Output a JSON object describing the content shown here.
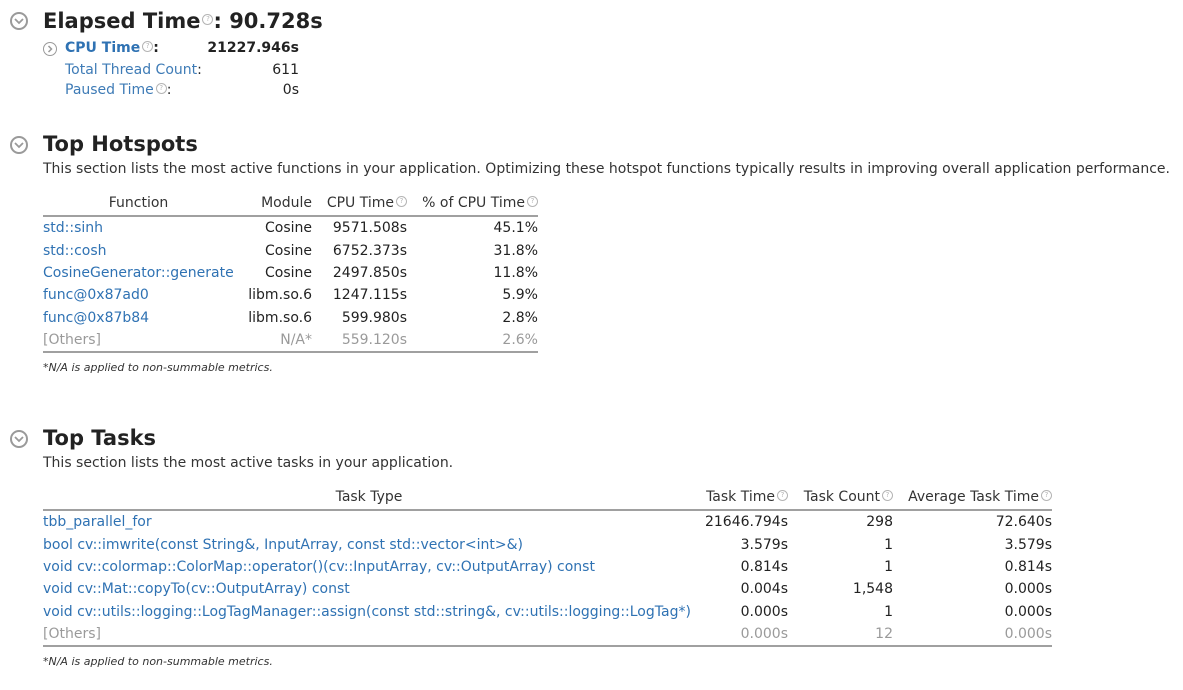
{
  "elapsed": {
    "title": "Elapsed Time",
    "value": ": 90.728s",
    "metrics": [
      {
        "label": "CPU Time",
        "value": "21227.946s"
      },
      {
        "label": "Total Thread Count",
        "value": "611"
      },
      {
        "label": "Paused Time",
        "value": "0s"
      }
    ]
  },
  "hotspots": {
    "title": "Top Hotspots",
    "description": "This section lists the most active functions in your application. Optimizing these hotspot functions typically results in improving overall application performance.",
    "headers": [
      "Function",
      "Module",
      "CPU Time",
      "% of CPU Time"
    ],
    "rows": [
      [
        "std::sinh",
        "Cosine",
        "9571.508s",
        "45.1%"
      ],
      [
        "std::cosh",
        "Cosine",
        "6752.373s",
        "31.8%"
      ],
      [
        "CosineGenerator::generate",
        "Cosine",
        "2497.850s",
        "11.8%"
      ],
      [
        "func@0x87ad0",
        "libm.so.6",
        "1247.115s",
        "5.9%"
      ],
      [
        "func@0x87b84",
        "libm.so.6",
        "599.980s",
        "2.8%"
      ],
      [
        "[Others]",
        "N/A*",
        "559.120s",
        "2.6%"
      ]
    ],
    "footnote": "*N/A is applied to non-summable metrics."
  },
  "tasks": {
    "title": "Top Tasks",
    "description": "This section lists the most active tasks in your application.",
    "headers": [
      "Task Type",
      "Task Time",
      "Task Count",
      "Average Task Time"
    ],
    "rows": [
      [
        "tbb_parallel_for",
        "21646.794s",
        "298",
        "72.640s"
      ],
      [
        "bool cv::imwrite(const String&, InputArray, const std::vector<int>&)",
        "3.579s",
        "1",
        "3.579s"
      ],
      [
        "void cv::colormap::ColorMap::operator()(cv::InputArray, cv::OutputArray) const",
        "0.814s",
        "1",
        "0.814s"
      ],
      [
        "void cv::Mat::copyTo(cv::OutputArray) const",
        "0.004s",
        "1,548",
        "0.000s"
      ],
      [
        "void cv::utils::logging::LogTagManager::assign(const std::string&, cv::utils::logging::LogTag*)",
        "0.000s",
        "1",
        "0.000s"
      ],
      [
        "[Others]",
        "0.000s",
        "12",
        "0.000s"
      ]
    ],
    "footnote": "*N/A is applied to non-summable metrics."
  },
  "colors": {
    "link": "#2f72b3",
    "muted": "#9a9a9a",
    "rule": "#a0a0a0"
  }
}
